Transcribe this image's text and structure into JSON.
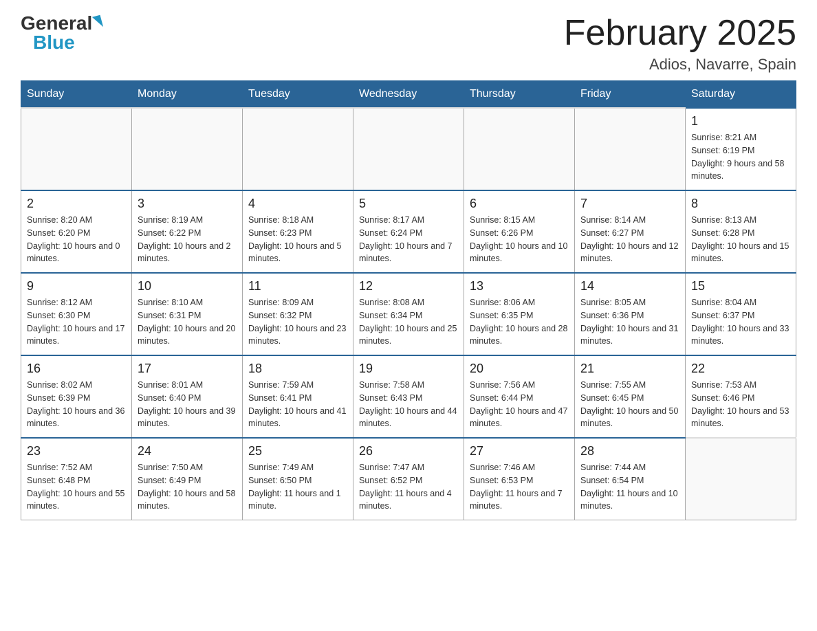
{
  "header": {
    "logo_general": "General",
    "logo_blue": "Blue",
    "month_year": "February 2025",
    "location": "Adios, Navarre, Spain"
  },
  "weekdays": [
    "Sunday",
    "Monday",
    "Tuesday",
    "Wednesday",
    "Thursday",
    "Friday",
    "Saturday"
  ],
  "weeks": [
    [
      {
        "day": "",
        "info": ""
      },
      {
        "day": "",
        "info": ""
      },
      {
        "day": "",
        "info": ""
      },
      {
        "day": "",
        "info": ""
      },
      {
        "day": "",
        "info": ""
      },
      {
        "day": "",
        "info": ""
      },
      {
        "day": "1",
        "info": "Sunrise: 8:21 AM\nSunset: 6:19 PM\nDaylight: 9 hours and 58 minutes."
      }
    ],
    [
      {
        "day": "2",
        "info": "Sunrise: 8:20 AM\nSunset: 6:20 PM\nDaylight: 10 hours and 0 minutes."
      },
      {
        "day": "3",
        "info": "Sunrise: 8:19 AM\nSunset: 6:22 PM\nDaylight: 10 hours and 2 minutes."
      },
      {
        "day": "4",
        "info": "Sunrise: 8:18 AM\nSunset: 6:23 PM\nDaylight: 10 hours and 5 minutes."
      },
      {
        "day": "5",
        "info": "Sunrise: 8:17 AM\nSunset: 6:24 PM\nDaylight: 10 hours and 7 minutes."
      },
      {
        "day": "6",
        "info": "Sunrise: 8:15 AM\nSunset: 6:26 PM\nDaylight: 10 hours and 10 minutes."
      },
      {
        "day": "7",
        "info": "Sunrise: 8:14 AM\nSunset: 6:27 PM\nDaylight: 10 hours and 12 minutes."
      },
      {
        "day": "8",
        "info": "Sunrise: 8:13 AM\nSunset: 6:28 PM\nDaylight: 10 hours and 15 minutes."
      }
    ],
    [
      {
        "day": "9",
        "info": "Sunrise: 8:12 AM\nSunset: 6:30 PM\nDaylight: 10 hours and 17 minutes."
      },
      {
        "day": "10",
        "info": "Sunrise: 8:10 AM\nSunset: 6:31 PM\nDaylight: 10 hours and 20 minutes."
      },
      {
        "day": "11",
        "info": "Sunrise: 8:09 AM\nSunset: 6:32 PM\nDaylight: 10 hours and 23 minutes."
      },
      {
        "day": "12",
        "info": "Sunrise: 8:08 AM\nSunset: 6:34 PM\nDaylight: 10 hours and 25 minutes."
      },
      {
        "day": "13",
        "info": "Sunrise: 8:06 AM\nSunset: 6:35 PM\nDaylight: 10 hours and 28 minutes."
      },
      {
        "day": "14",
        "info": "Sunrise: 8:05 AM\nSunset: 6:36 PM\nDaylight: 10 hours and 31 minutes."
      },
      {
        "day": "15",
        "info": "Sunrise: 8:04 AM\nSunset: 6:37 PM\nDaylight: 10 hours and 33 minutes."
      }
    ],
    [
      {
        "day": "16",
        "info": "Sunrise: 8:02 AM\nSunset: 6:39 PM\nDaylight: 10 hours and 36 minutes."
      },
      {
        "day": "17",
        "info": "Sunrise: 8:01 AM\nSunset: 6:40 PM\nDaylight: 10 hours and 39 minutes."
      },
      {
        "day": "18",
        "info": "Sunrise: 7:59 AM\nSunset: 6:41 PM\nDaylight: 10 hours and 41 minutes."
      },
      {
        "day": "19",
        "info": "Sunrise: 7:58 AM\nSunset: 6:43 PM\nDaylight: 10 hours and 44 minutes."
      },
      {
        "day": "20",
        "info": "Sunrise: 7:56 AM\nSunset: 6:44 PM\nDaylight: 10 hours and 47 minutes."
      },
      {
        "day": "21",
        "info": "Sunrise: 7:55 AM\nSunset: 6:45 PM\nDaylight: 10 hours and 50 minutes."
      },
      {
        "day": "22",
        "info": "Sunrise: 7:53 AM\nSunset: 6:46 PM\nDaylight: 10 hours and 53 minutes."
      }
    ],
    [
      {
        "day": "23",
        "info": "Sunrise: 7:52 AM\nSunset: 6:48 PM\nDaylight: 10 hours and 55 minutes."
      },
      {
        "day": "24",
        "info": "Sunrise: 7:50 AM\nSunset: 6:49 PM\nDaylight: 10 hours and 58 minutes."
      },
      {
        "day": "25",
        "info": "Sunrise: 7:49 AM\nSunset: 6:50 PM\nDaylight: 11 hours and 1 minute."
      },
      {
        "day": "26",
        "info": "Sunrise: 7:47 AM\nSunset: 6:52 PM\nDaylight: 11 hours and 4 minutes."
      },
      {
        "day": "27",
        "info": "Sunrise: 7:46 AM\nSunset: 6:53 PM\nDaylight: 11 hours and 7 minutes."
      },
      {
        "day": "28",
        "info": "Sunrise: 7:44 AM\nSunset: 6:54 PM\nDaylight: 11 hours and 10 minutes."
      },
      {
        "day": "",
        "info": ""
      }
    ]
  ]
}
